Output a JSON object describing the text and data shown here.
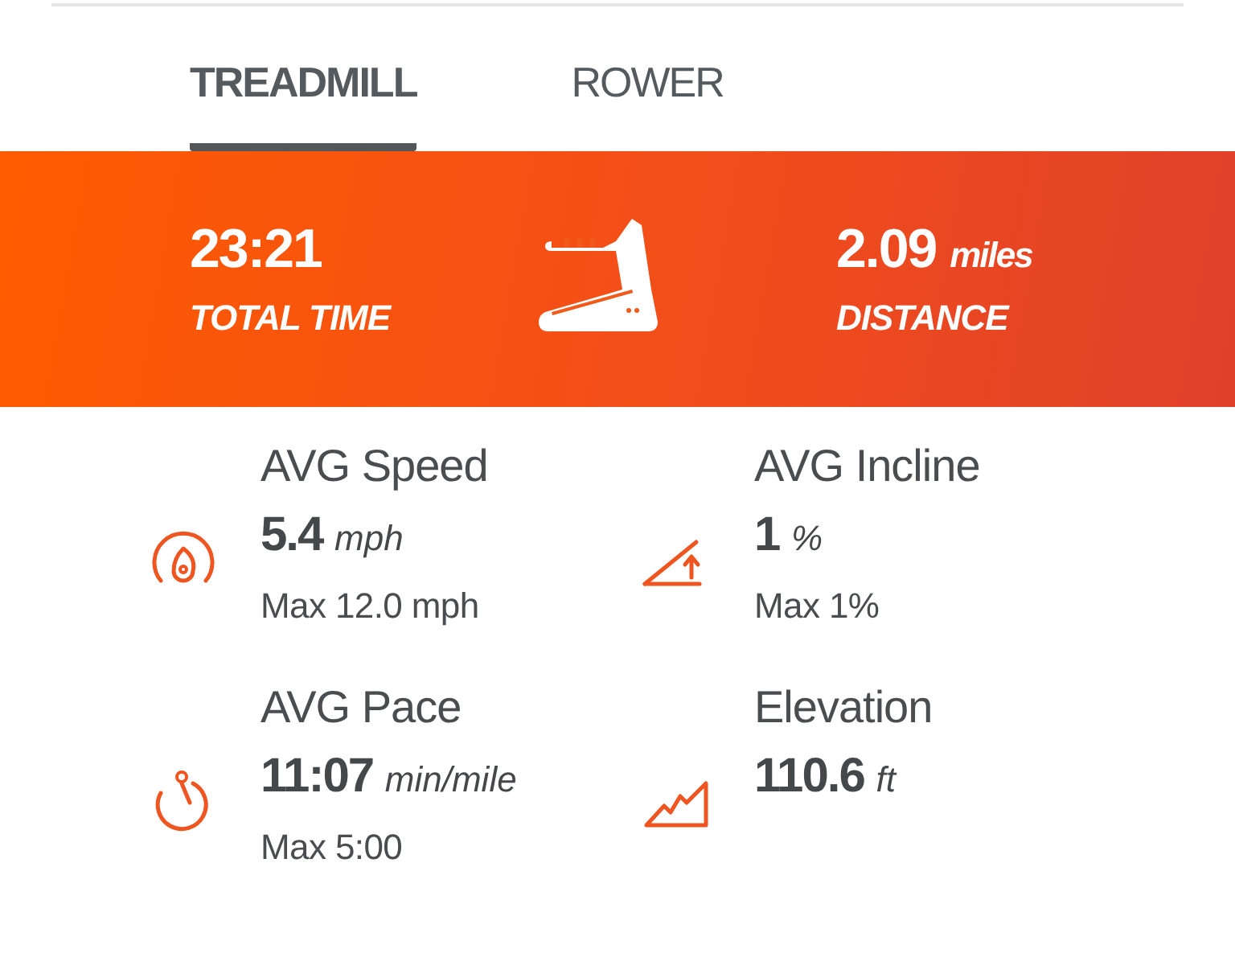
{
  "tabs": [
    {
      "label": "TREADMILL",
      "selected": true
    },
    {
      "label": "ROWER",
      "selected": false
    }
  ],
  "summary": {
    "time": "23:21",
    "time_label": "TOTAL TIME",
    "distance": "2.09",
    "distance_unit": "miles",
    "distance_label": "DISTANCE"
  },
  "stats": [
    {
      "kind": "speed",
      "title": "AVG Speed",
      "value": "5.4",
      "unit": "mph",
      "max": "Max 12.0 mph"
    },
    {
      "kind": "incline",
      "title": "AVG Incline",
      "value": "1",
      "unit": "%",
      "max": "Max 1%"
    },
    {
      "kind": "pace",
      "title": "AVG Pace",
      "value": "11:07",
      "unit": "min/mile",
      "max": "Max 5:00"
    },
    {
      "kind": "elevation",
      "title": "Elevation",
      "value": "110.6",
      "unit": "ft"
    }
  ]
}
